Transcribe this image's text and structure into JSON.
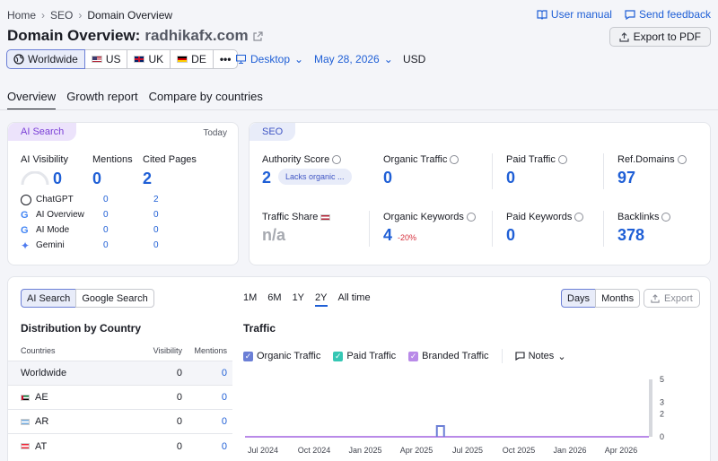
{
  "breadcrumb": [
    "Home",
    "SEO",
    "Domain Overview"
  ],
  "header": {
    "user_manual": "User manual",
    "feedback": "Send feedback",
    "title_prefix": "Domain Overview:",
    "domain": "radhikafx.com",
    "export_pdf": "Export to PDF"
  },
  "geo": {
    "worldwide": "Worldwide",
    "countries": [
      "US",
      "UK",
      "DE"
    ],
    "more": "•••"
  },
  "filters": {
    "device": "Desktop",
    "date": "May 28, 2026",
    "currency": "USD"
  },
  "tabs": [
    "Overview",
    "Growth report",
    "Compare by countries"
  ],
  "ai_card": {
    "badge": "AI Search",
    "today": "Today",
    "visibility_label": "AI Visibility",
    "visibility_value": "0",
    "mentions_label": "Mentions",
    "mentions_value": "0",
    "cited_label": "Cited Pages",
    "cited_value": "2",
    "rows": [
      {
        "name": "ChatGPT",
        "mentions": "0",
        "cited": "2"
      },
      {
        "name": "AI Overview",
        "mentions": "0",
        "cited": "0"
      },
      {
        "name": "AI Mode",
        "mentions": "0",
        "cited": "0"
      },
      {
        "name": "Gemini",
        "mentions": "0",
        "cited": "0"
      }
    ]
  },
  "seo_card": {
    "badge": "SEO",
    "authority_label": "Authority Score",
    "authority_value": "2",
    "authority_tag": "Lacks organic ...",
    "organic_traffic_label": "Organic Traffic",
    "organic_traffic_value": "0",
    "paid_traffic_label": "Paid Traffic",
    "paid_traffic_value": "0",
    "refdomains_label": "Ref.Domains",
    "refdomains_value": "97",
    "traffic_share_label": "Traffic Share",
    "traffic_share_value": "n/a",
    "organic_kw_label": "Organic Keywords",
    "organic_kw_value": "4",
    "organic_kw_change": "-20%",
    "paid_kw_label": "Paid Keywords",
    "paid_kw_value": "0",
    "backlinks_label": "Backlinks",
    "backlinks_value": "378"
  },
  "bottom": {
    "toggle": [
      "AI Search",
      "Google Search"
    ],
    "ranges": [
      "1M",
      "6M",
      "1Y",
      "2Y",
      "All time"
    ],
    "active_range": "2Y",
    "granularity": [
      "Days",
      "Months"
    ],
    "export": "Export",
    "dist_title": "Distribution by Country",
    "col_countries": "Countries",
    "col_visibility": "Visibility",
    "col_mentions": "Mentions",
    "rows": [
      {
        "name": "Worldwide",
        "visibility": "0",
        "mentions": "0"
      },
      {
        "name": "AE",
        "visibility": "0",
        "mentions": "0"
      },
      {
        "name": "AR",
        "visibility": "0",
        "mentions": "0"
      },
      {
        "name": "AT",
        "visibility": "0",
        "mentions": "0"
      }
    ],
    "traffic_title": "Traffic",
    "legend": [
      "Organic Traffic",
      "Paid Traffic",
      "Branded Traffic"
    ],
    "notes": "Notes"
  },
  "colors": {
    "accent": "#1f5fd6",
    "organic": "#6b7fd6",
    "paid": "#35c7b4",
    "branded": "#b98ae8",
    "ai_badge": "#ece3fb",
    "seo_badge": "#e8ecf9"
  },
  "chart_data": {
    "type": "line",
    "title": "Traffic",
    "x": [
      "Jul 2024",
      "Oct 2024",
      "Jan 2025",
      "Apr 2025",
      "Jul 2025",
      "Oct 2025",
      "Jan 2026",
      "Apr 2026"
    ],
    "y_ticks": [
      "5",
      "3",
      "2",
      "0"
    ],
    "series": [
      {
        "name": "Organic Traffic",
        "values": [
          0,
          0,
          0,
          0,
          0,
          0,
          0,
          0
        ]
      },
      {
        "name": "Branded Traffic",
        "values": [
          0,
          0,
          0,
          0,
          0,
          0,
          0,
          0
        ]
      }
    ],
    "ylim": [
      0,
      5
    ]
  }
}
